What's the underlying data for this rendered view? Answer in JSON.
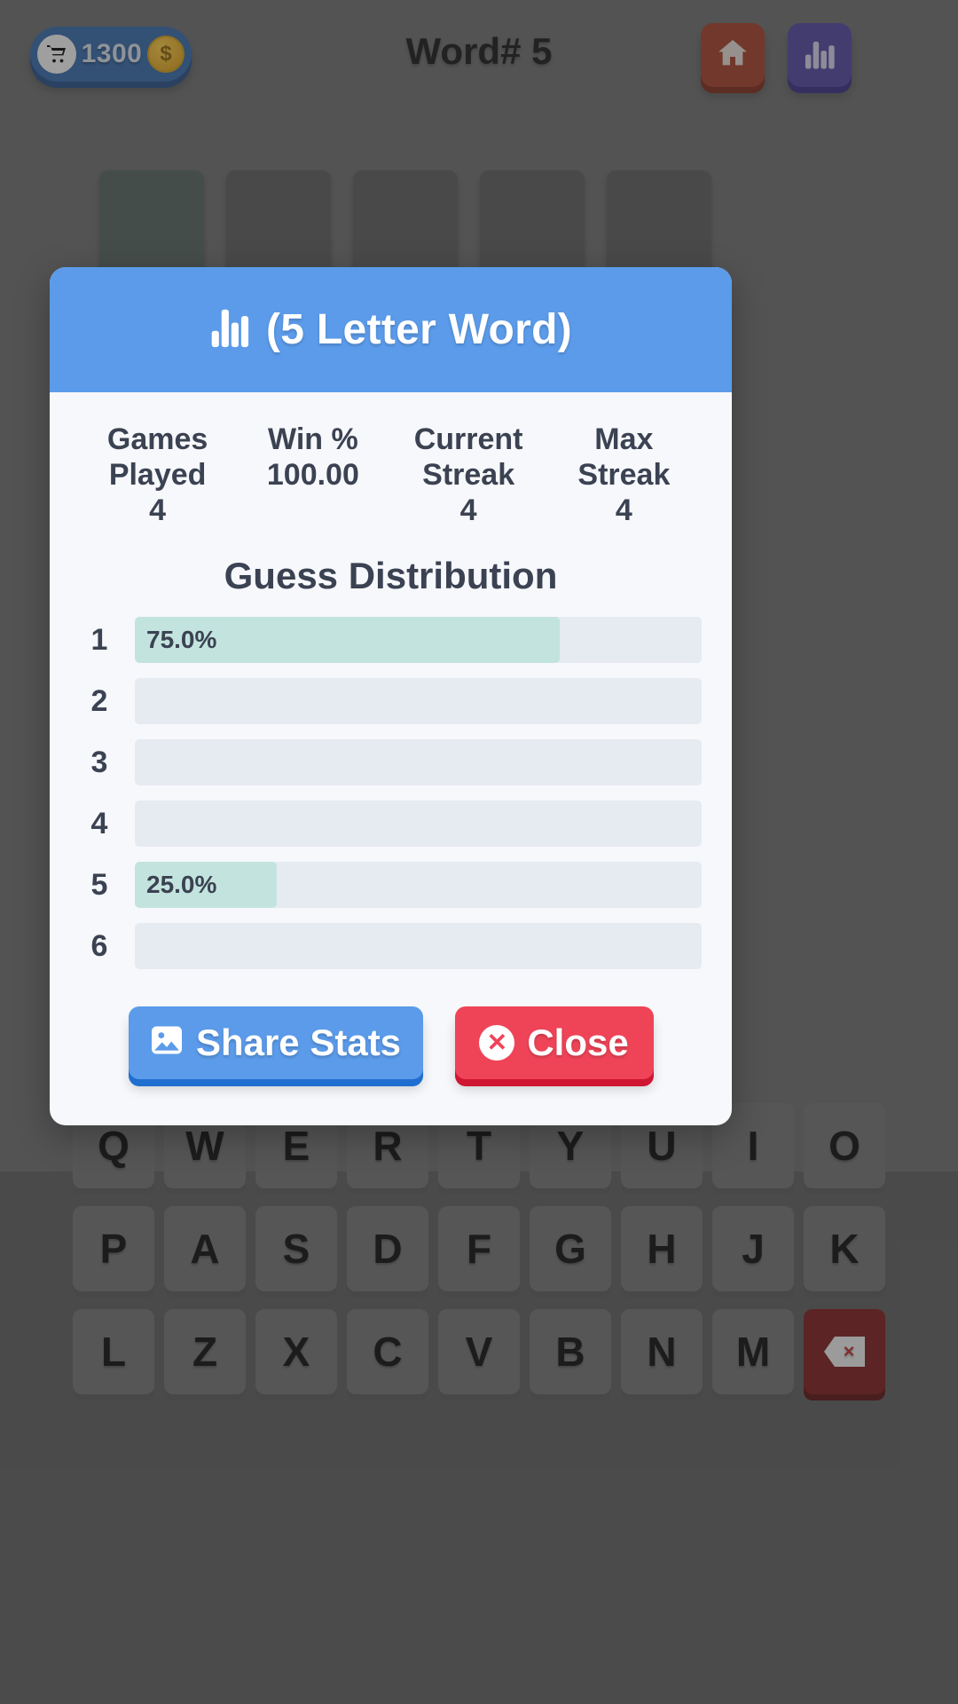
{
  "topbar": {
    "coin_badge": {
      "cart_icon": "shopping-cart-icon",
      "count": "1300",
      "coin_icon": "coin-icon",
      "coin_symbol": "$"
    },
    "title": "Word# 5",
    "home_icon": "home-icon",
    "stats_icon": "bar-chart-icon"
  },
  "board": {
    "tiles": [
      {
        "letter": "",
        "state": "correct"
      },
      {
        "letter": "",
        "state": "empty"
      },
      {
        "letter": "",
        "state": "empty"
      },
      {
        "letter": "",
        "state": "empty"
      },
      {
        "letter": "",
        "state": "empty"
      }
    ]
  },
  "keyboard": {
    "rows": [
      [
        "Q",
        "W",
        "E",
        "R",
        "T",
        "Y",
        "U",
        "I",
        "O"
      ],
      [
        "P",
        "A",
        "S",
        "D",
        "F",
        "G",
        "H",
        "J",
        "K"
      ],
      [
        "L",
        "Z",
        "X",
        "C",
        "V",
        "B",
        "N",
        "M"
      ]
    ],
    "backspace_icon": "backspace-icon",
    "backspace_glyph": "×"
  },
  "modal": {
    "header_icon": "bar-chart-icon",
    "title": "(5 Letter Word)",
    "stats": [
      {
        "label": "Games Played",
        "value": "4"
      },
      {
        "label": "Win %",
        "value": "100.00"
      },
      {
        "label": "Current Streak",
        "value": "4"
      },
      {
        "label": "Max Streak",
        "value": "4"
      }
    ],
    "distribution_title": "Guess Distribution",
    "share_label": "Share Stats",
    "share_icon": "image-icon",
    "close_label": "Close",
    "close_icon": "close-circle-icon"
  },
  "chart_data": {
    "type": "bar",
    "title": "Guess Distribution",
    "orientation": "horizontal",
    "categories": [
      "1",
      "2",
      "3",
      "4",
      "5",
      "6"
    ],
    "values": [
      75.0,
      0,
      0,
      0,
      25.0,
      0
    ],
    "labels": [
      "75.0%",
      "",
      "",
      "",
      "25.0%",
      ""
    ],
    "xlabel": "",
    "ylabel": "",
    "xlim": [
      0,
      100
    ],
    "grid": false,
    "legend": false,
    "fill_color": "#c3e4de",
    "track_color": "#e6eaf1"
  },
  "colors": {
    "accent_blue": "#5b9bea",
    "danger_red": "#ef4458",
    "home_red": "#a0432f",
    "stats_purple": "#554a9c",
    "coin_blue": "#3a6aa5",
    "bar_fill": "#c3e4de",
    "bar_track": "#e6eaf1",
    "modal_bg": "#f7f8fb",
    "text_dark": "#3b4252"
  }
}
